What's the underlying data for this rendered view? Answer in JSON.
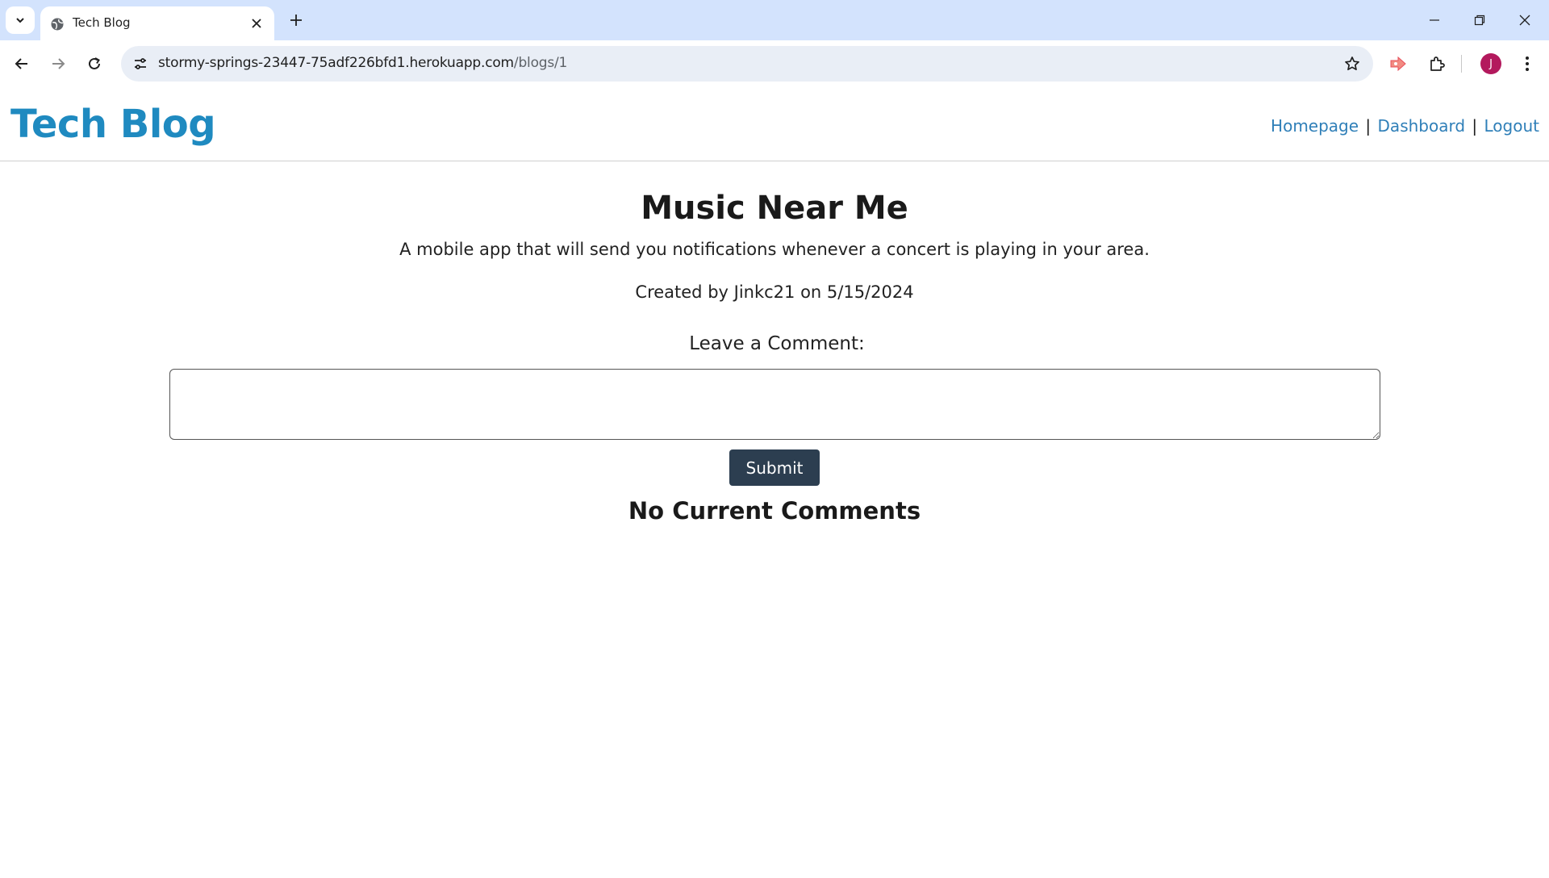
{
  "browser": {
    "tab_title": "Tech Blog",
    "url_host": "stormy-springs-23447-75adf226bfd1.herokuapp.com",
    "url_path": "/blogs/1",
    "profile_initial": "J",
    "profile_color": "#b3195d"
  },
  "header": {
    "brand": "Tech Blog",
    "nav": {
      "homepage": "Homepage",
      "dashboard": "Dashboard",
      "logout": "Logout",
      "separator": "|"
    },
    "brand_color": "#1f8ac0",
    "link_color": "#2f7fb8"
  },
  "post": {
    "title": "Music Near Me",
    "description": "A mobile app that will send you notifications whenever a concert is playing in your area.",
    "meta": "Created by Jinkc21 on 5/15/2024"
  },
  "comment_form": {
    "label": "Leave a Comment:",
    "value": "",
    "submit_label": "Submit",
    "button_color": "#2c3e50"
  },
  "comments": {
    "empty_message": "No Current Comments"
  }
}
